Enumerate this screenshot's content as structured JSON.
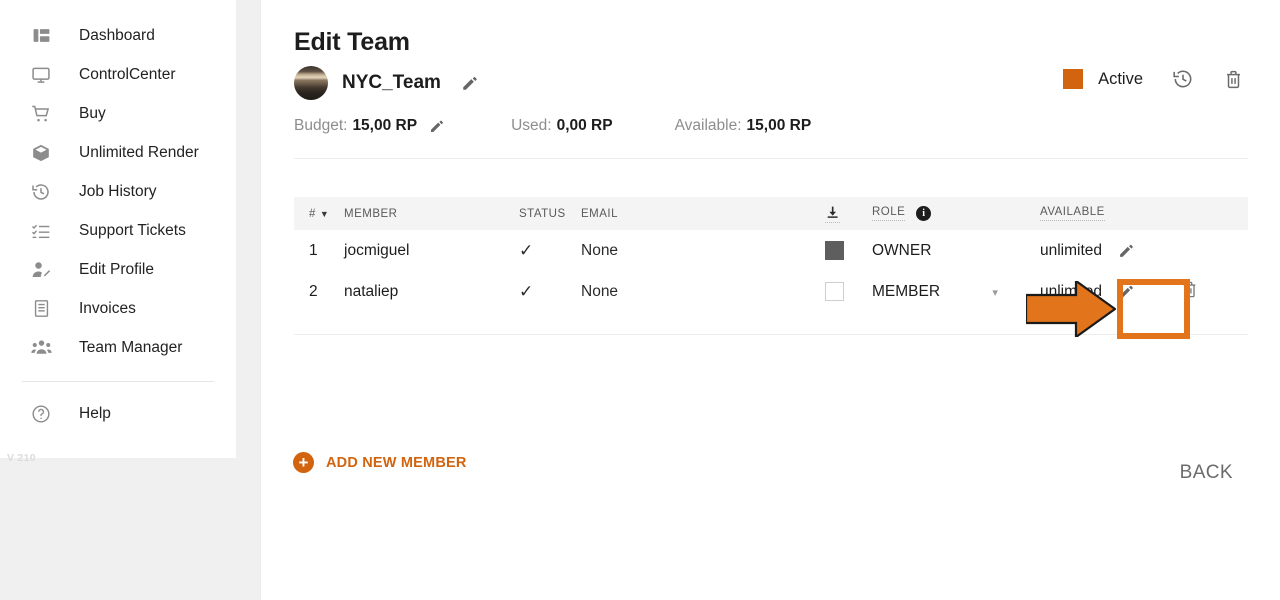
{
  "sidebar": {
    "items": [
      {
        "label": "Dashboard",
        "icon": "dashboard-icon"
      },
      {
        "label": "ControlCenter",
        "icon": "monitor-icon"
      },
      {
        "label": "Buy",
        "icon": "cart-icon"
      },
      {
        "label": "Unlimited Render",
        "icon": "box-icon"
      },
      {
        "label": "Job History",
        "icon": "history-icon"
      },
      {
        "label": "Support Tickets",
        "icon": "checklist-icon"
      },
      {
        "label": "Edit Profile",
        "icon": "user-edit-icon"
      },
      {
        "label": "Invoices",
        "icon": "invoice-icon"
      },
      {
        "label": "Team Manager",
        "icon": "team-icon"
      }
    ],
    "help": {
      "label": "Help",
      "icon": "help-circle-icon"
    },
    "version": "V 210"
  },
  "header": {
    "title": "Edit Team",
    "team_name": "NYC_Team",
    "edit_team_icon": "pencil-icon",
    "avatar": "team-avatar",
    "budget_label": "Budget:",
    "budget_value": "15,00 RP",
    "budget_edit_icon": "pencil-icon",
    "used_label": "Used:",
    "used_value": "0,00 RP",
    "available_label": "Available:",
    "available_value": "15,00 RP",
    "status_label": "Active",
    "status_color": "#d2640f",
    "history_icon": "history-icon",
    "delete_icon": "trash-icon"
  },
  "table": {
    "columns": {
      "num": "#",
      "sort_caret": "▼",
      "member": "MEMBER",
      "status": "STATUS",
      "email": "EMAIL",
      "download_icon": "download-icon",
      "role": "ROLE",
      "role_info_icon": "info-icon",
      "role_info_glyph": "i",
      "available": "AVAILABLE"
    },
    "rows": [
      {
        "num": "1",
        "member": "jocmiguel",
        "status": "✓",
        "email": "None",
        "checkbox": "filled",
        "role": "OWNER",
        "role_has_dropdown": false,
        "available": "unlimited",
        "available_edit_icon": "pencil-icon",
        "has_delete": false
      },
      {
        "num": "2",
        "member": "nataliep",
        "status": "✓",
        "email": "None",
        "checkbox": "empty",
        "role": "MEMBER",
        "role_has_dropdown": true,
        "role_caret": "▾",
        "available": "unlimited",
        "available_edit_icon": "pencil-icon",
        "has_delete": true,
        "delete_icon": "trash-icon"
      }
    ]
  },
  "footer": {
    "add_member_label": "ADD NEW MEMBER",
    "add_member_icon": "plus-circle-icon",
    "back_label": "BACK"
  },
  "annotations": {
    "arrow_color": "#e2741c",
    "highlight_color": "#e2741c",
    "arrow_target": "available-edit-pencil-row-2",
    "highlight_target": "available-edit-pencil-row-2"
  }
}
